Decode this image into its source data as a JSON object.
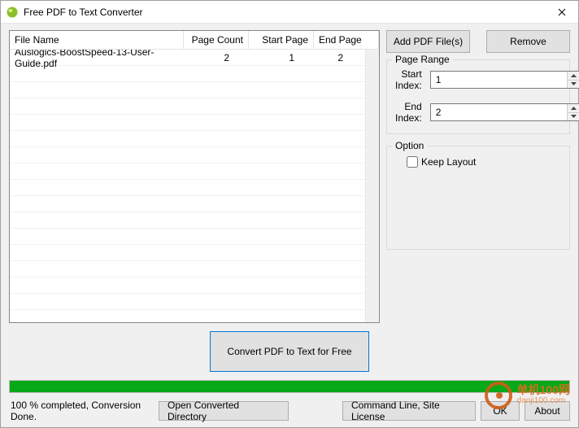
{
  "window": {
    "title": "Free PDF to Text Converter"
  },
  "table": {
    "headers": {
      "file": "File Name",
      "count": "Page Count",
      "start": "Start Page",
      "end": "End Page"
    },
    "rows": [
      {
        "file": "Auslogics-BoostSpeed-13-User-Guide.pdf",
        "count": "2",
        "start": "1",
        "end": "2"
      }
    ]
  },
  "buttons": {
    "add": "Add PDF File(s)",
    "remove": "Remove",
    "convert": "Convert PDF to Text for Free",
    "open_dir": "Open Converted Directory",
    "command_line": "Command Line, Site License",
    "ok": "OK",
    "about": "About"
  },
  "page_range": {
    "legend": "Page Range",
    "start_label": "Start Index:",
    "end_label": "End Index:",
    "start_value": "1",
    "end_value": "2"
  },
  "option": {
    "legend": "Option",
    "keep_layout": "Keep Layout"
  },
  "status": "100 % completed, Conversion Done.",
  "watermark": {
    "main": "单机100网",
    "sub": "danji100.com"
  }
}
